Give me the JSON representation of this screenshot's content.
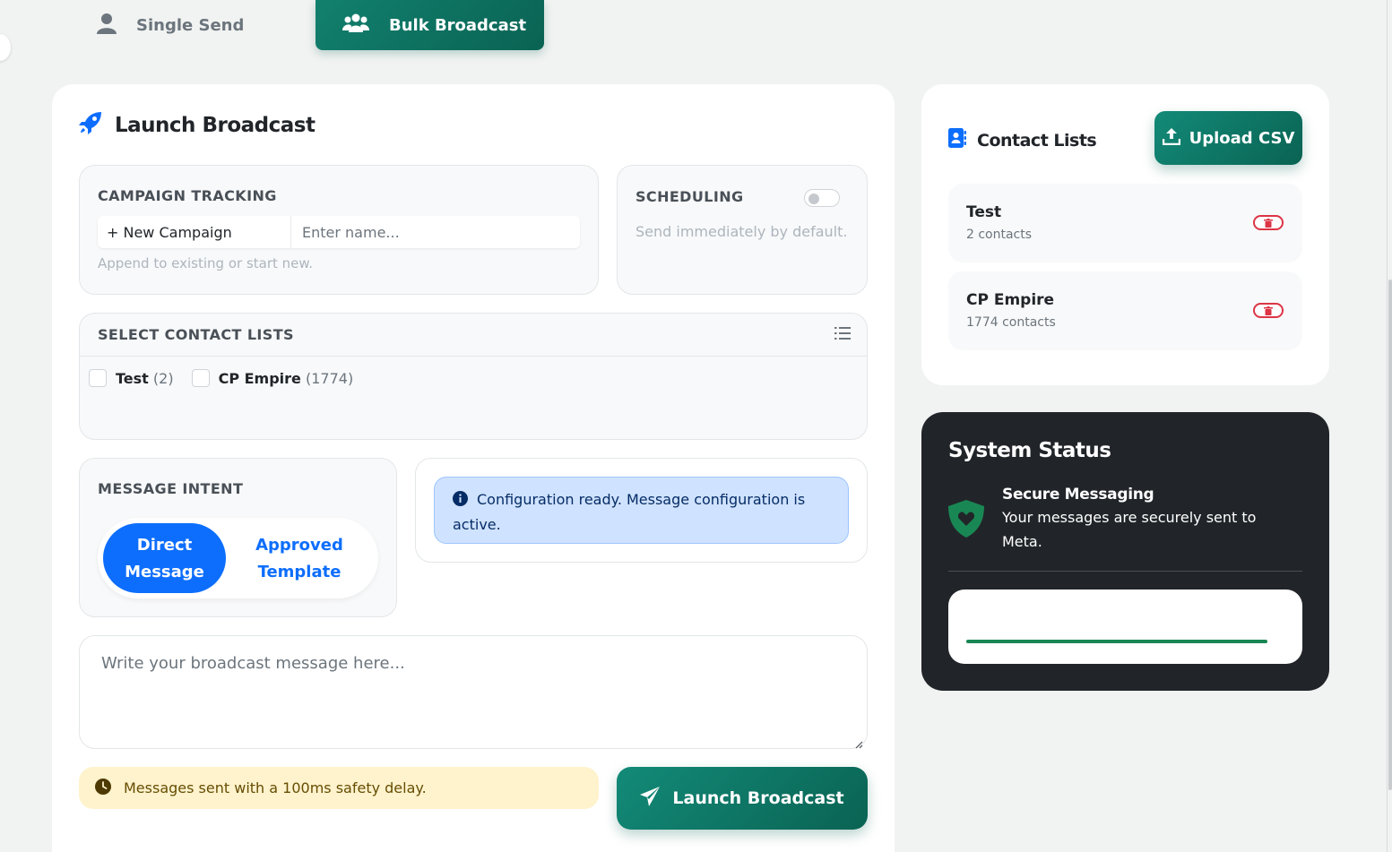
{
  "tabs": {
    "single": "Single Send",
    "bulk": "Bulk Broadcast"
  },
  "broadcast": {
    "title": "Launch Broadcast",
    "campaign": {
      "label": "Campaign Tracking",
      "select_value": "+ New Campaign",
      "name_placeholder": "Enter name...",
      "help": "Append to existing or start new."
    },
    "scheduling": {
      "label": "Scheduling",
      "help": "Send immediately by default.",
      "enabled": false
    },
    "contacts": {
      "label": "Select Contact Lists",
      "options": [
        {
          "name": "Test",
          "count": "(2)"
        },
        {
          "name": "CP Empire",
          "count": "(1774)"
        }
      ]
    },
    "intent": {
      "label": "Message Intent",
      "active": "Direct Message",
      "inactive": "Approved Template"
    },
    "config_alert": "Configuration ready. Message configuration is active.",
    "message_placeholder": "Write your broadcast message here...",
    "delay_note": "Messages sent with a 100ms safety delay.",
    "launch_label": "Launch Broadcast"
  },
  "contact_lists": {
    "title": "Contact Lists",
    "upload_label": "Upload CSV",
    "items": [
      {
        "name": "Test",
        "count": "2 contacts"
      },
      {
        "name": "CP Empire",
        "count": "1774 contacts"
      }
    ]
  },
  "system_status": {
    "title": "System Status",
    "secure_title": "Secure Messaging",
    "secure_text": "Your messages are securely sent to Meta.",
    "progress_fraction": 1.0
  },
  "colors": {
    "brand": "#0f7a68",
    "primary": "#0d6efd",
    "danger": "#dc3545",
    "success": "#198754",
    "dark": "#212529"
  },
  "icons": {
    "single_tab": "user-icon",
    "bulk_tab": "users-icon",
    "title": "rocket-icon",
    "contacts_header": "list-icon",
    "config": "info-icon",
    "delay": "clock-icon",
    "launch": "paper-plane-icon",
    "contact_lists": "address-book-icon",
    "upload": "upload-icon",
    "delete": "trash-icon",
    "secure": "shield-heart-icon"
  }
}
